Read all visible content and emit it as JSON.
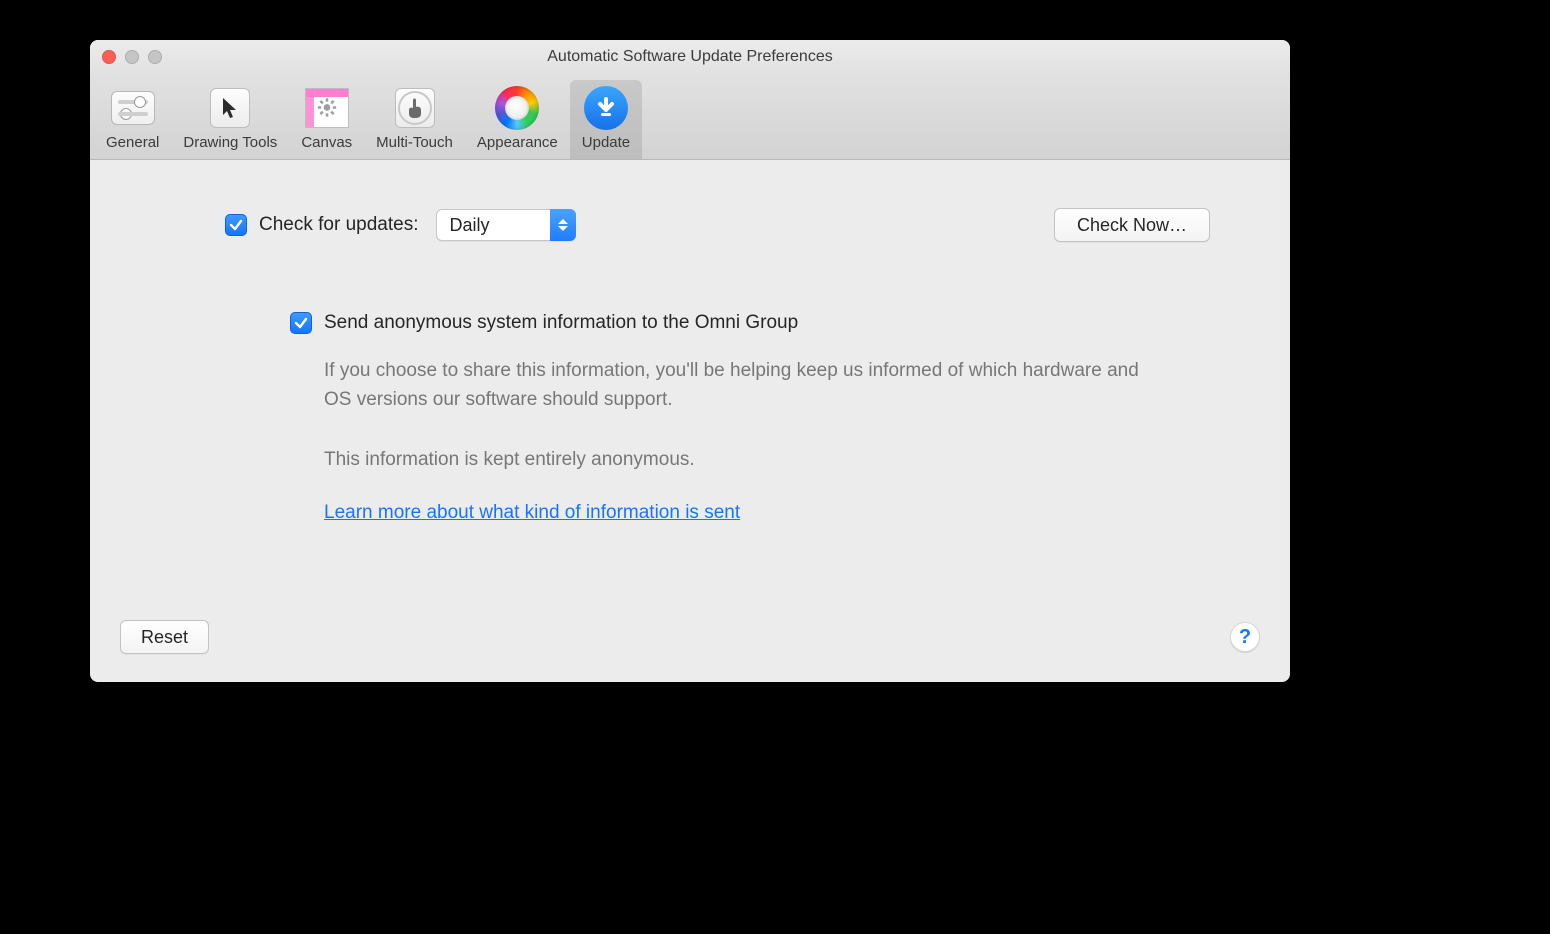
{
  "window": {
    "title": "Automatic Software Update Preferences"
  },
  "tabs": [
    {
      "label": "General"
    },
    {
      "label": "Drawing Tools"
    },
    {
      "label": "Canvas"
    },
    {
      "label": "Multi-Touch"
    },
    {
      "label": "Appearance"
    },
    {
      "label": "Update"
    }
  ],
  "update": {
    "checkForUpdatesLabel": "Check for updates:",
    "frequency": "Daily",
    "checkNowLabel": "Check Now…",
    "sendInfoLabel": "Send anonymous system information to the Omni Group",
    "desc1": "If you choose to share this information, you'll be helping keep us informed of which hardware and OS versions our software should support.",
    "desc2": "This information is kept entirely anonymous.",
    "learnMore": "Learn more about what kind of information is sent"
  },
  "footer": {
    "resetLabel": "Reset",
    "helpLabel": "?"
  }
}
